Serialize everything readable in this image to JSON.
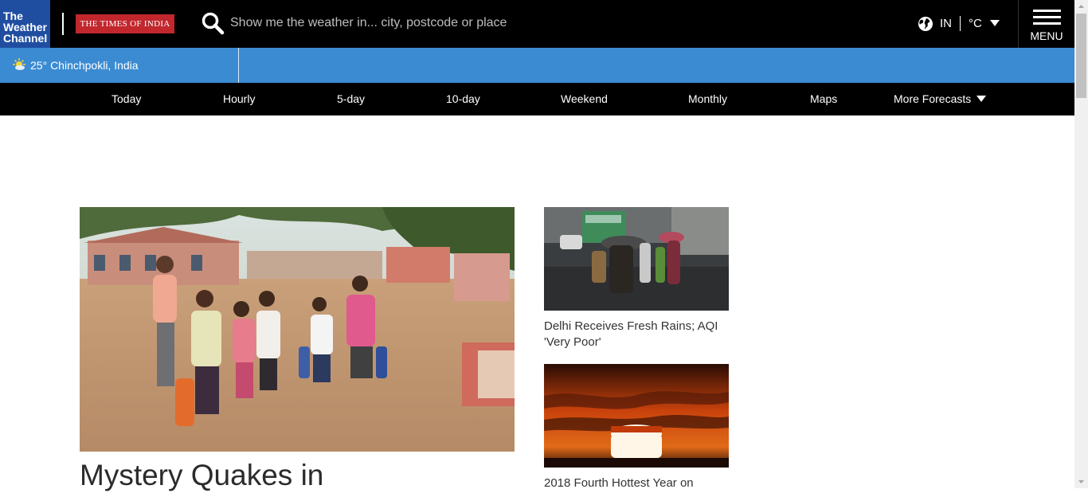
{
  "header": {
    "logo_line1": "The",
    "logo_line2": "Weather",
    "logo_line3": "Channel",
    "partner": "THE TIMES OF INDIA",
    "search_placeholder": "Show me the weather in... city, postcode or place",
    "country": "IN",
    "unit": "°C",
    "menu_label": "MENU"
  },
  "location": {
    "temperature": "25°",
    "place": "Chinchpokli, India"
  },
  "nav": {
    "items": [
      "Today",
      "Hourly",
      "5-day",
      "10-day",
      "Weekend",
      "Monthly",
      "Maps",
      "More Forecasts"
    ]
  },
  "articles": {
    "main_title": "Mystery Quakes in",
    "side1_title_line1": "Delhi Receives Fresh Rains; AQI",
    "side1_title_line2": "'Very Poor'",
    "side2_title": "2018 Fourth Hottest Year on"
  },
  "colors": {
    "topbar": "#000000",
    "logo_bg": "#1f4ea1",
    "partner_bg": "#c2272d",
    "location_bar": "#3b8bd3"
  }
}
